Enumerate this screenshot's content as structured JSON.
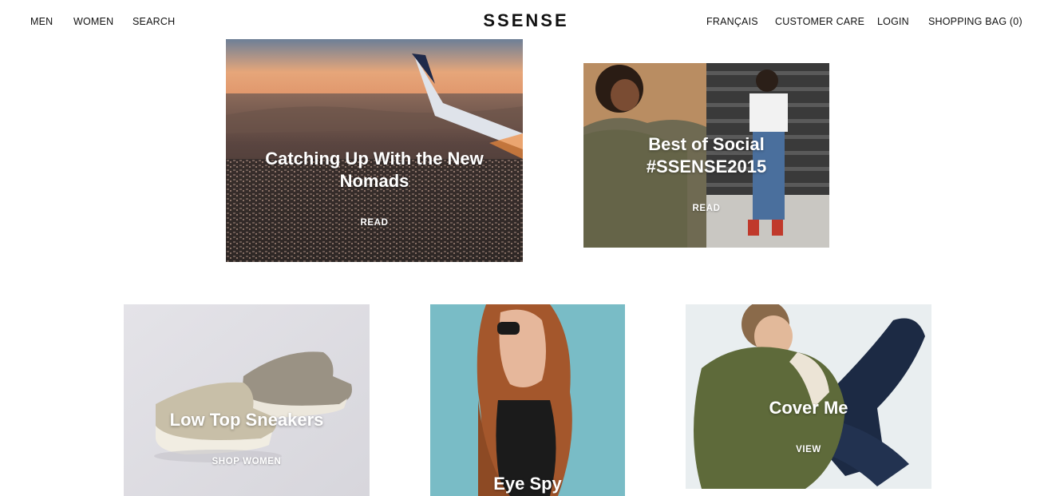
{
  "header": {
    "nav_left": [
      "MEN",
      "WOMEN",
      "SEARCH"
    ],
    "logo": "SSENSE",
    "nav_right": [
      "FRANÇAIS",
      "CUSTOMER CARE",
      "LOGIN",
      "SHOPPING BAG (0)"
    ]
  },
  "tiles": [
    {
      "title": "Catching Up With the New Nomads",
      "cta": "READ"
    },
    {
      "title": "Best of Social #SSENSE2015",
      "cta": "READ"
    },
    {
      "title": "Low Top Sneakers",
      "cta": "SHOP WOMEN"
    },
    {
      "title": "Eye Spy",
      "cta": ""
    },
    {
      "title": "Cover Me",
      "cta": "VIEW"
    }
  ],
  "colors": {
    "text": "#111111",
    "background": "#ffffff",
    "overlay_text": "#ffffff"
  }
}
